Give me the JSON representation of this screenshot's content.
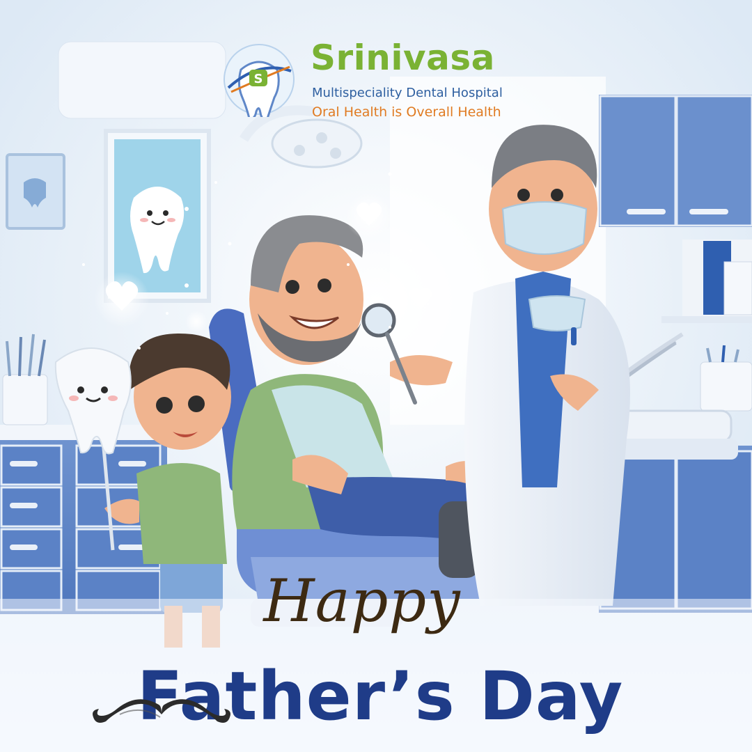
{
  "logo": {
    "name": "Srinivasa",
    "subtitle": "Multispeciality Dental Hospital",
    "tagline": "Oral Health is Overall Health",
    "mark_letter": "S"
  },
  "greeting": {
    "line1": "Happy",
    "line2": "Father’s Day"
  },
  "colors": {
    "brand_green": "#7ab234",
    "brand_blue": "#2e5fa0",
    "tagline_orange": "#e07b22",
    "headline_blue": "#1f3c88",
    "headline_brown": "#3d2a12"
  },
  "icons": [
    "tooth-logo-icon",
    "mustache-icon",
    "heart-icon",
    "tooth-mascot-icon",
    "dental-mirror-icon"
  ]
}
